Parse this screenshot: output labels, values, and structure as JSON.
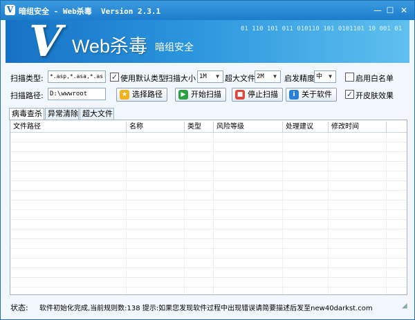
{
  "window": {
    "icon_letter": "V",
    "title": "暗组安全 - Web杀毒  Version 2.3.1",
    "min_glyph": "—",
    "max_glyph": "☐",
    "close_glyph": "✕"
  },
  "banner": {
    "logo_letter": "V",
    "product": "Web杀毒",
    "company": "暗组安全",
    "binary_line1": "01 110 101 011 010110 101 0101101 10   001 01"
  },
  "options": {
    "scan_type_label": "扫描类型:",
    "scan_type_value": "*.asp,*.asa,*.as",
    "use_default_type_label": "使用默认类型",
    "use_default_type_checked": true,
    "scan_size_label": "扫描大小",
    "scan_size_value": "1M",
    "big_file_label": "超大文件",
    "big_file_value": "2M",
    "heuristic_label": "启发精度",
    "heuristic_value": "中",
    "whitelist_label": "启用白名单",
    "whitelist_checked": false,
    "scan_path_label": "扫描路径:",
    "scan_path_value": "D:\\wwwroot",
    "skin_label": "开皮肤效果",
    "skin_checked": true
  },
  "buttons": {
    "choose_path": "选择路径",
    "start_scan": "开始扫描",
    "stop_scan": "停止扫描",
    "about": "关于软件"
  },
  "tabs": [
    "病毒查杀",
    "异常清除",
    "超大文件"
  ],
  "table": {
    "columns": [
      "文件路径",
      "名称",
      "类型",
      "风险等级",
      "处理建议",
      "修改时间",
      ""
    ]
  },
  "status": {
    "label": "状态:",
    "text": "软件初始化完成,当前规则数:138 提示:如果您发现软件过程中出现错误请简要描述后发至new40darkst.com"
  },
  "colors": {
    "title_bar": "#1d7ccb",
    "banner_start": "#1671c4",
    "banner_end": "#5fc0ef",
    "start_icon": "#2ea043",
    "stop_icon": "#e0463a",
    "about_icon": "#2b7fd4",
    "choose_icon": "#f0b21e"
  },
  "icons": {
    "choose_path": "star-icon",
    "start_scan": "play-icon",
    "stop_scan": "stop-icon",
    "about": "info-icon"
  }
}
